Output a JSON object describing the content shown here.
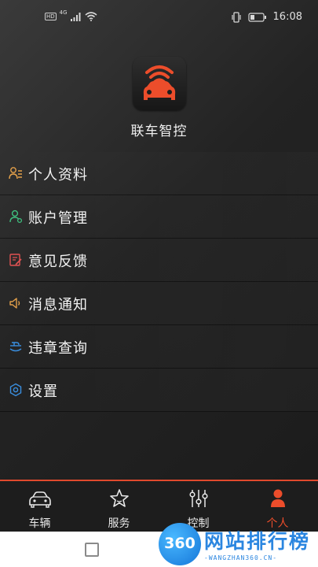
{
  "status_bar": {
    "hd": "HD",
    "network": "4G",
    "time": "16:08"
  },
  "app": {
    "name": "联车智控",
    "accent_color": "#ec4d2b"
  },
  "menu": [
    {
      "label": "个人资料",
      "icon": "profile-icon",
      "color": "#e3a04a"
    },
    {
      "label": "账户管理",
      "icon": "account-icon",
      "color": "#3fbf7f"
    },
    {
      "label": "意见反馈",
      "icon": "feedback-icon",
      "color": "#e25353"
    },
    {
      "label": "消息通知",
      "icon": "speaker-icon",
      "color": "#e3a04a"
    },
    {
      "label": "违章查询",
      "icon": "violation-icon",
      "color": "#3a8fe0"
    },
    {
      "label": "设置",
      "icon": "gear-icon",
      "color": "#3a8fe0"
    }
  ],
  "bottom_nav": {
    "tabs": [
      {
        "label": "车辆",
        "icon": "car-icon",
        "active": false
      },
      {
        "label": "服务",
        "icon": "star-icon",
        "active": false
      },
      {
        "label": "控制",
        "icon": "sliders-icon",
        "active": false
      },
      {
        "label": "个人",
        "icon": "person-icon",
        "active": true
      }
    ]
  },
  "watermark": {
    "logo": "360",
    "title": "网站排行榜",
    "subtitle": "-WANGZHAN360.CN-"
  }
}
